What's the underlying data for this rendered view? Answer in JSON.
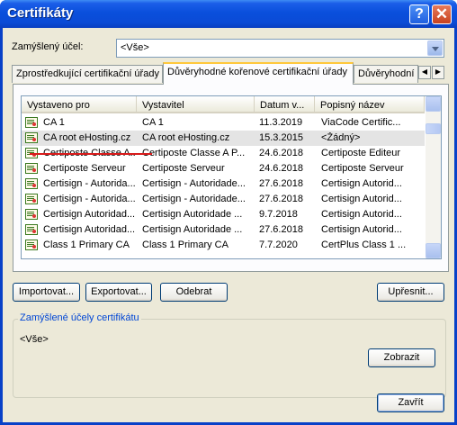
{
  "window": {
    "title": "Certifikáty"
  },
  "purpose": {
    "label": "Zamýšlený účel:",
    "value": "<Vše>"
  },
  "tabs": [
    {
      "label": "Zprostředkující certifikační úřady",
      "active": false
    },
    {
      "label": "Důvěryhodné kořenové certifikační úřady",
      "active": true
    },
    {
      "label": "Důvěryhodní",
      "active": false
    }
  ],
  "table": {
    "columns": [
      "Vystaveno pro",
      "Vystavitel",
      "Datum v...",
      "Popisný název"
    ],
    "rows": [
      [
        "CA 1",
        "CA 1",
        "11.3.2019",
        "ViaCode Certific..."
      ],
      [
        "CA root eHosting.cz",
        "CA root eHosting.cz",
        "15.3.2015",
        "<Žádný>"
      ],
      [
        "Certiposte Classe A...",
        "Certiposte Classe A P...",
        "24.6.2018",
        "Certiposte Editeur"
      ],
      [
        "Certiposte Serveur",
        "Certiposte Serveur",
        "24.6.2018",
        "Certiposte Serveur"
      ],
      [
        "Certisign - Autorida...",
        "Certisign - Autoridade...",
        "27.6.2018",
        "Certisign Autorid..."
      ],
      [
        "Certisign - Autorida...",
        "Certisign - Autoridade...",
        "27.6.2018",
        "Certisign Autorid..."
      ],
      [
        "Certisign Autoridad...",
        "Certisign Autoridade ...",
        "9.7.2018",
        "Certisign Autorid..."
      ],
      [
        "Certisign Autoridad...",
        "Certisign Autoridade ...",
        "27.6.2018",
        "Certisign Autorid..."
      ],
      [
        "Class 1 Primary CA",
        "Class 1 Primary CA",
        "7.7.2020",
        "CertPlus Class 1 ..."
      ]
    ],
    "selected_index": 1
  },
  "buttons": {
    "import": "Importovat...",
    "export": "Exportovat...",
    "remove": "Odebrat",
    "advanced": "Upřesnit...",
    "view": "Zobrazit",
    "close": "Zavřít"
  },
  "group": {
    "title": "Zamýšlené účely certifikátu",
    "value": "<Vše>"
  },
  "colors": {
    "title_bar": "#0a4fdc",
    "highlight": "#d81a1a",
    "group_title": "#0046d5"
  }
}
